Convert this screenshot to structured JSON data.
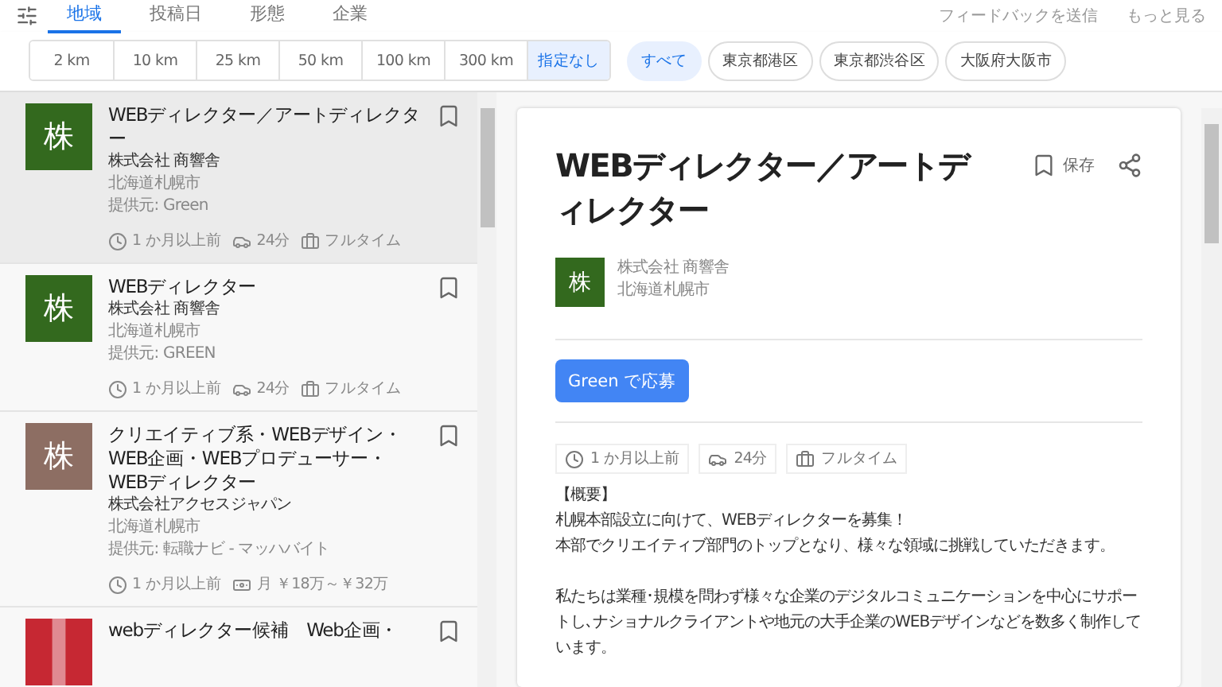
{
  "filter_tabs": [
    {
      "label": "地域",
      "selected": true
    },
    {
      "label": "投稿日",
      "selected": false
    },
    {
      "label": "形態",
      "selected": false
    },
    {
      "label": "企業",
      "selected": false
    }
  ],
  "header_links": [
    "フィードバックを送信",
    "もっと見る"
  ],
  "distance_chips": [
    {
      "label": "2 km",
      "selected": false
    },
    {
      "label": "10 km",
      "selected": false
    },
    {
      "label": "25 km",
      "selected": false
    },
    {
      "label": "50 km",
      "selected": false
    },
    {
      "label": "100 km",
      "selected": false
    },
    {
      "label": "300 km",
      "selected": false
    },
    {
      "label": "指定なし",
      "selected": true
    }
  ],
  "location_chips": [
    {
      "label": "すべて",
      "selected": true
    },
    {
      "label": "東京都港区",
      "selected": false
    },
    {
      "label": "東京都渋谷区",
      "selected": false
    },
    {
      "label": "大阪府大阪市",
      "selected": false
    }
  ],
  "jobs": [
    {
      "selected": true,
      "logo": {
        "kind": "letter",
        "text": "株",
        "color": "#33691e"
      },
      "title": "WEBディレクター／アートディレクター",
      "company": "株式会社 商響舎",
      "location": "北海道札幌市",
      "source": "提供元: Green",
      "meta": [
        {
          "kind": "time",
          "text": "1 か月以上前"
        },
        {
          "kind": "commute",
          "text": "24分"
        },
        {
          "kind": "type",
          "text": "フルタイム"
        }
      ]
    },
    {
      "selected": false,
      "logo": {
        "kind": "letter",
        "text": "株",
        "color": "#33691e"
      },
      "title": "WEBディレクター",
      "company": "株式会社 商響舎",
      "location": "北海道札幌市",
      "source": "提供元: GREEN",
      "meta": [
        {
          "kind": "time",
          "text": "1 か月以上前"
        },
        {
          "kind": "commute",
          "text": "24分"
        },
        {
          "kind": "type",
          "text": "フルタイム"
        }
      ]
    },
    {
      "selected": false,
      "logo": {
        "kind": "letter",
        "text": "株",
        "color": "#8d6e63"
      },
      "title": "クリエイティブ系・WEBデザイン・WEB企画・WEBプロデューサー・WEBディレクター",
      "company": "株式会社アクセスジャパン",
      "location": "北海道札幌市",
      "source": "提供元: 転職ナビ - マッハバイト",
      "meta": [
        {
          "kind": "time",
          "text": "1 か月以上前"
        },
        {
          "kind": "salary",
          "text": "月 ￥18万～￥32万"
        }
      ]
    },
    {
      "selected": false,
      "logo": {
        "kind": "image",
        "color": "#c62833"
      },
      "title": "webディレクター候補　Web企画・"
    }
  ],
  "detail": {
    "title": "WEBディレクター／アートディレクター",
    "save_label": "保存",
    "logo": {
      "kind": "letter",
      "text": "株",
      "color": "#33691e"
    },
    "company": "株式会社 商響舎",
    "location": "北海道札幌市",
    "apply_button": "Green で応募",
    "meta": [
      {
        "kind": "time",
        "text": "1 か月以上前"
      },
      {
        "kind": "commute",
        "text": "24分"
      },
      {
        "kind": "type",
        "text": "フルタイム"
      }
    ],
    "description": [
      {
        "lines": [
          "【概要】",
          "札幌本部設立に向けて、WEBディレクターを募集！",
          "本部でクリエイティブ部門のトップとなり、様々な領域に挑戦していただきます。"
        ]
      },
      {
        "lines": [
          "私たちは業種･規模を問わず様々な企業のデジタルコミュニケーションを中心にサポートし､ナショナルクライアントや地元の大手企業のWEBデザインなどを数多く制作しています。"
        ]
      }
    ]
  }
}
